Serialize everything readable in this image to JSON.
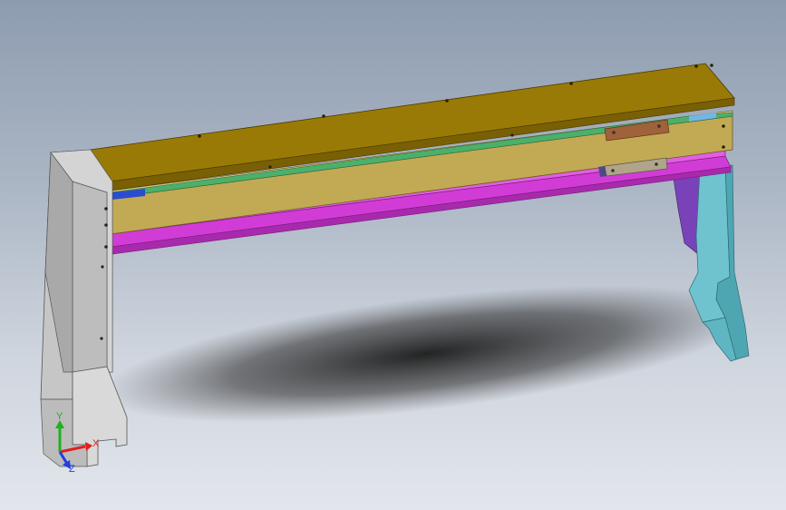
{
  "viewport": {
    "background_top": "#8e9cb0",
    "background_bottom": "#e2e6ec"
  },
  "parts": {
    "top_plate": "#9a7a06",
    "front_beam": "#c2aa55",
    "magenta_rail": "#d23cd6",
    "left_leg": "#c9c9c9",
    "right_leg": "#6fc3cf",
    "purple_brace": "#7a42b8",
    "slider_brown": "#a0623a",
    "slider_gray": "#b0a48a"
  },
  "triad": {
    "x_label": "X",
    "y_label": "Y",
    "z_label": "Z",
    "x_color": "#e02020",
    "y_color": "#20b020",
    "z_color": "#2040e0"
  }
}
